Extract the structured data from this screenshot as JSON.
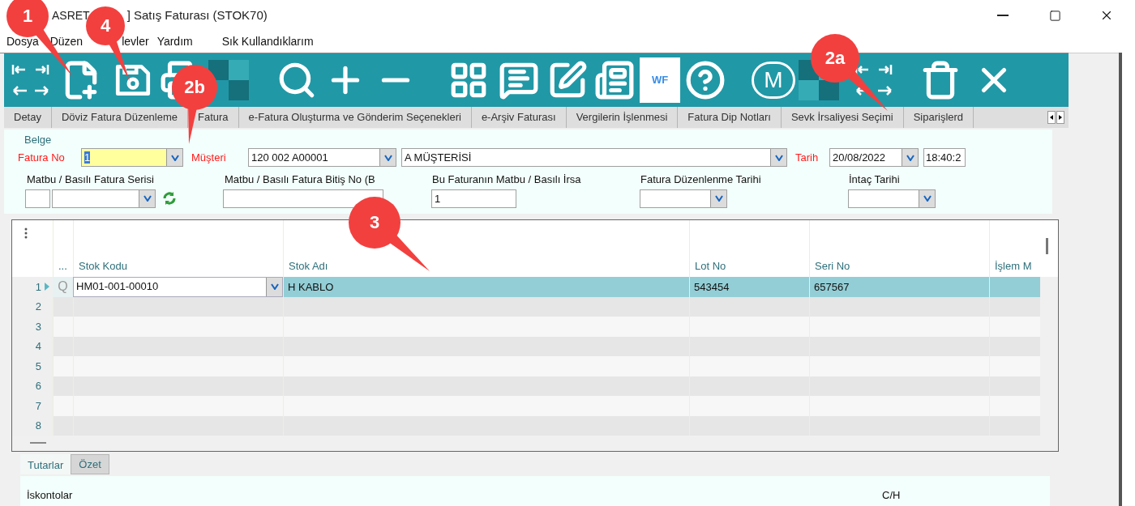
{
  "window": {
    "title_parts": [
      "ASRET",
      "] Satış Faturası (STOK70)"
    ]
  },
  "menu": [
    "Dosya",
    "Düzen",
    "levler",
    "Yardım",
    "Sık Kullandıklarım"
  ],
  "toolbar": [
    {
      "kind": "nav"
    },
    {
      "kind": "new"
    },
    {
      "kind": "save"
    },
    {
      "kind": "print"
    },
    {
      "kind": "checker"
    },
    {
      "kind": "search"
    },
    {
      "kind": "plus"
    },
    {
      "kind": "minus"
    },
    {
      "kind": "grid"
    },
    {
      "kind": "message"
    },
    {
      "kind": "edit"
    },
    {
      "kind": "list"
    },
    {
      "kind": "badge",
      "label": "WF"
    },
    {
      "kind": "help"
    },
    {
      "kind": "letter",
      "label": "M"
    },
    {
      "kind": "checker"
    },
    {
      "kind": "nav"
    },
    {
      "kind": "trash"
    },
    {
      "kind": "close"
    }
  ],
  "tabs": [
    {
      "label": "Detay",
      "selected": false
    },
    {
      "label": "Döviz Fatura Düzenleme",
      "selected": false
    },
    {
      "label": "Fatura",
      "selected": false
    },
    {
      "label": "e-Fatura Oluşturma ve Gönderim Seçenekleri",
      "selected": false
    },
    {
      "label": "e-Arşiv Faturası",
      "selected": false
    },
    {
      "label": "Vergilerin İşlenmesi",
      "selected": false
    },
    {
      "label": "Fatura Dip Notları",
      "selected": false
    },
    {
      "label": "Sevk İrsaliyesi Seçimi",
      "selected": false
    },
    {
      "label": "Siparişlerd",
      "selected": false
    }
  ],
  "form": {
    "group": "Belge",
    "invoice_no_label": "Fatura No",
    "invoice_no": "1",
    "customer_label": "Müşteri",
    "customer_code": "120 002 A00001",
    "customer_name": "A MÜŞTERİSİ",
    "date_label": "Tarih",
    "date": "20/08/2022",
    "time": "18:40:2",
    "series_label": "Matbu / Basılı Fatura Serisi",
    "end_no_label": "Matbu / Basılı Fatura Bitiş No (B",
    "printed_label": "Bu Faturanın Matbu / Basılı İrsa",
    "printed_value": "1",
    "issue_date_label": "Fatura Düzenlenme Tarihi",
    "intac_label": "İntaç Tarihi"
  },
  "grid": {
    "columns": [
      "...",
      "Stok Kodu",
      "Stok Adı",
      "Lot No",
      "Seri No",
      "İşlem M"
    ],
    "rows": [
      {
        "number": "1",
        "selected": true,
        "lookup": "Q",
        "cells": [
          "HM01-001-00010",
          "H KABLO",
          "543454",
          "657567"
        ]
      },
      {
        "number": "2",
        "selected": false
      },
      {
        "number": "3",
        "selected": false
      },
      {
        "number": "4",
        "selected": false
      },
      {
        "number": "5",
        "selected": false
      },
      {
        "number": "6",
        "selected": false
      },
      {
        "number": "7",
        "selected": false
      },
      {
        "number": "8",
        "selected": false
      }
    ]
  },
  "bottom_tabs": [
    {
      "label": "Tutarlar",
      "selected": true
    },
    {
      "label": "Özet",
      "selected": false
    }
  ],
  "summary": {
    "discounts_label": "İskontolar",
    "ch_label": "C/H"
  },
  "callouts": [
    {
      "label": "1"
    },
    {
      "label": "4"
    },
    {
      "label": "2b"
    },
    {
      "label": "2a"
    },
    {
      "label": "3"
    }
  ]
}
